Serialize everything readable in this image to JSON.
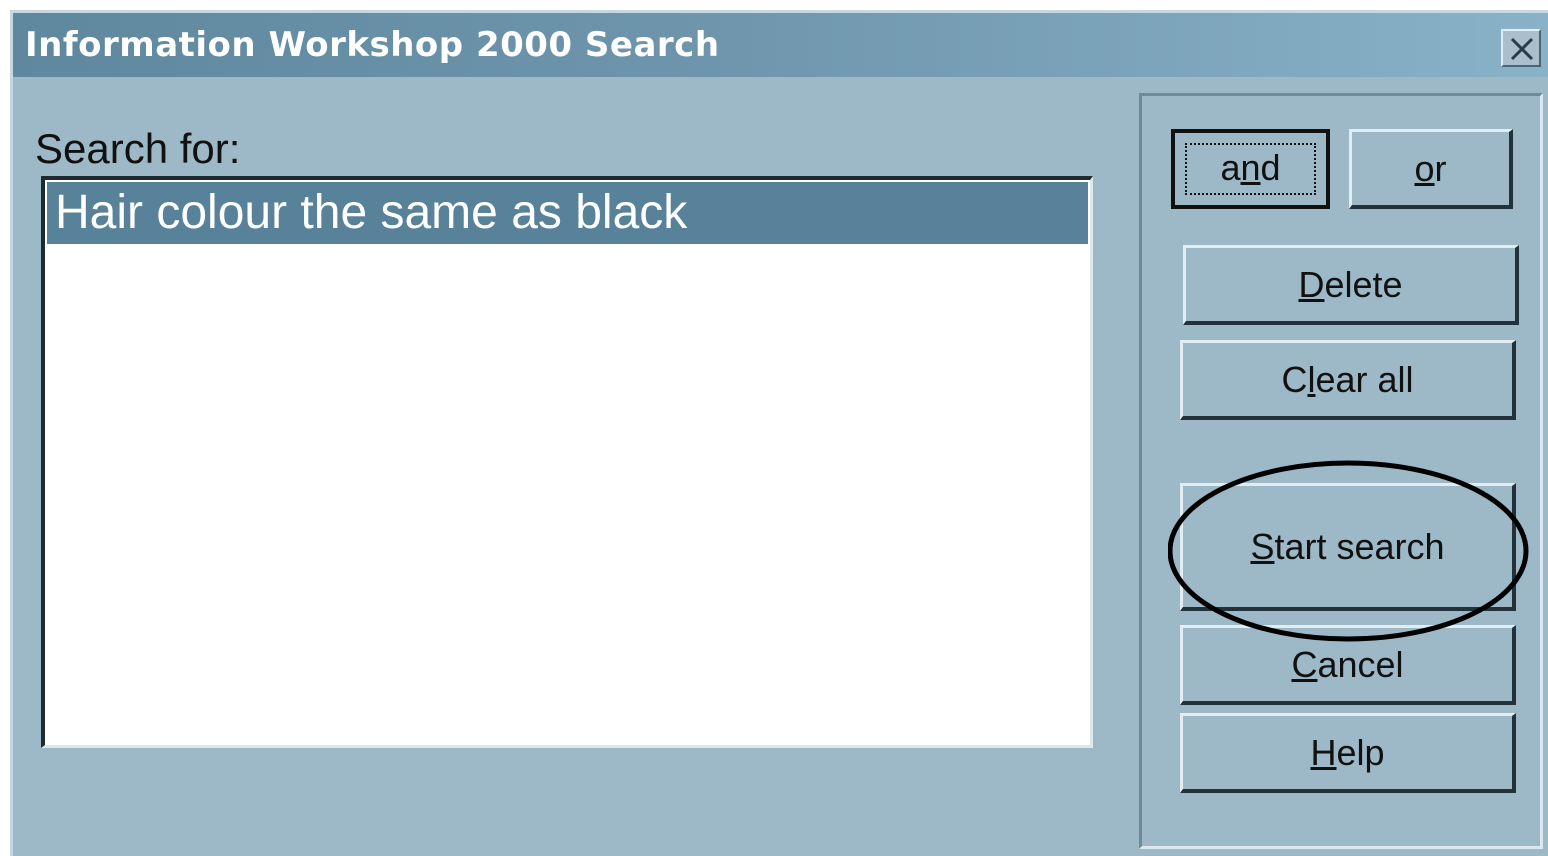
{
  "window": {
    "title": "Information Workshop 2000 Search"
  },
  "search": {
    "label": "Search for:",
    "items": [
      "Hair colour the same as black"
    ]
  },
  "buttons": {
    "and": {
      "pre": "a",
      "accel": "n",
      "post": "d"
    },
    "or": {
      "pre": "",
      "accel": "o",
      "post": "r"
    },
    "delete": {
      "pre": "",
      "accel": "D",
      "post": "elete"
    },
    "clear_all": {
      "pre": "C",
      "accel": "l",
      "post": "ear all"
    },
    "start_search": {
      "pre": "",
      "accel": "S",
      "post": "tart search"
    },
    "cancel": {
      "pre": "",
      "accel": "C",
      "post": "ancel"
    },
    "help": {
      "pre": "",
      "accel": "H",
      "post": "elp"
    }
  },
  "icons": {
    "close": "close-icon"
  },
  "colors": {
    "dialog_bg": "#9db8c6",
    "selection": "#58819a",
    "titlebar_start": "#5f889f",
    "titlebar_end": "#89b1c7"
  }
}
